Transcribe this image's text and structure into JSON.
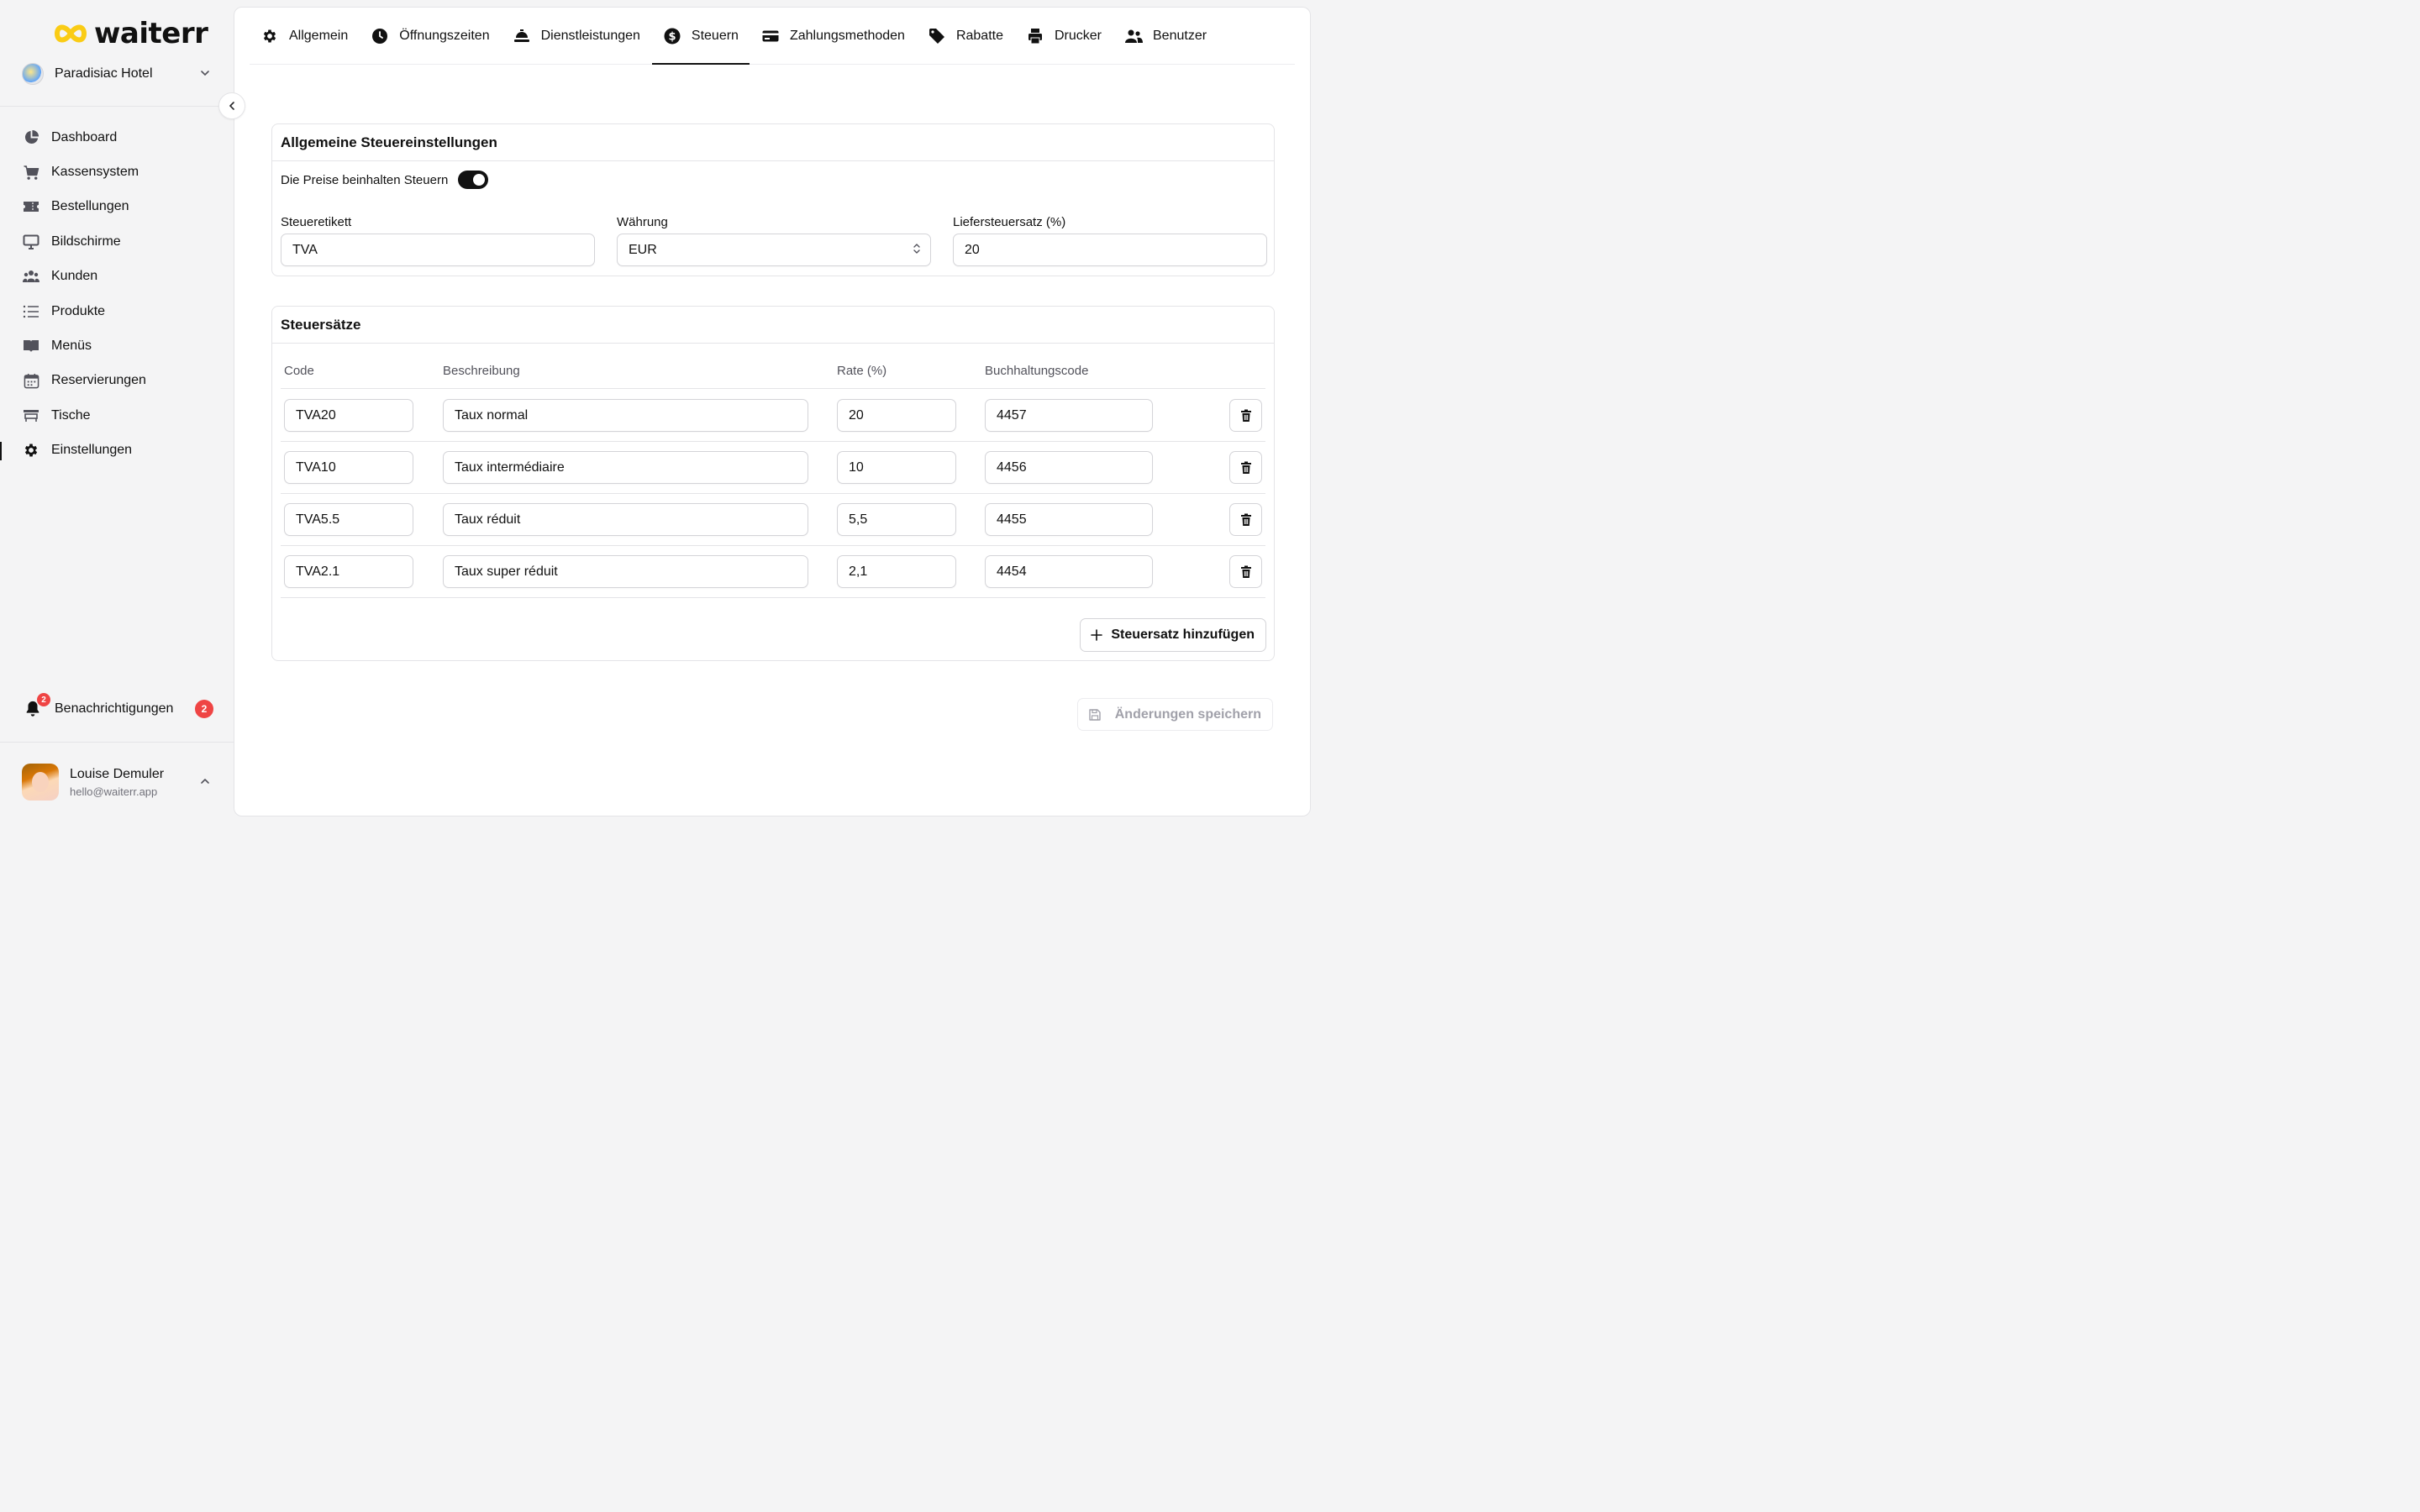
{
  "brand": {
    "name": "waiterr",
    "accent": "#facc15"
  },
  "hotel": {
    "name": "Paradisiac Hotel"
  },
  "nav": {
    "items": [
      {
        "label": "Dashboard",
        "icon": "pie-chart-icon"
      },
      {
        "label": "Kassensystem",
        "icon": "cart-icon"
      },
      {
        "label": "Bestellungen",
        "icon": "ticket-icon"
      },
      {
        "label": "Bildschirme",
        "icon": "monitor-icon"
      },
      {
        "label": "Kunden",
        "icon": "users-icon"
      },
      {
        "label": "Produkte",
        "icon": "list-icon"
      },
      {
        "label": "Menüs",
        "icon": "book-icon"
      },
      {
        "label": "Reservierungen",
        "icon": "calendar-icon"
      },
      {
        "label": "Tische",
        "icon": "table-icon"
      },
      {
        "label": "Einstellungen",
        "icon": "gear-icon"
      }
    ],
    "active": "Einstellungen"
  },
  "notifications": {
    "label": "Benachrichtigungen",
    "count": "2",
    "bell_count": "2"
  },
  "user": {
    "name": "Louise Demuler",
    "email": "hello@waiterr.app"
  },
  "tabs": [
    {
      "label": "Allgemein",
      "icon": "gear-icon"
    },
    {
      "label": "Öffnungszeiten",
      "icon": "clock-icon"
    },
    {
      "label": "Dienstleistungen",
      "icon": "service-bell-icon"
    },
    {
      "label": "Steuern",
      "icon": "dollar-circle-icon"
    },
    {
      "label": "Zahlungsmethoden",
      "icon": "credit-card-icon"
    },
    {
      "label": "Rabatte",
      "icon": "tag-icon"
    },
    {
      "label": "Drucker",
      "icon": "printer-icon"
    },
    {
      "label": "Benutzer",
      "icon": "user-group-icon"
    }
  ],
  "active_tab": "Steuern",
  "general": {
    "title": "Allgemeine Steuereinstellungen",
    "toggle_label": "Die Preise beinhalten Steuern",
    "toggle_on": true,
    "tax_label": {
      "label": "Steueretikett",
      "value": "TVA"
    },
    "currency": {
      "label": "Währung",
      "value": "EUR"
    },
    "delivery_rate": {
      "label": "Liefersteuersatz (%)",
      "value": "20"
    }
  },
  "rates": {
    "title": "Steuersätze",
    "columns": [
      "Code",
      "Beschreibung",
      "Rate (%)",
      "Buchhaltungscode"
    ],
    "rows": [
      {
        "code": "TVA20",
        "description": "Taux normal",
        "rate": "20",
        "accounting": "4457"
      },
      {
        "code": "TVA10",
        "description": "Taux intermédiaire",
        "rate": "10",
        "accounting": "4456"
      },
      {
        "code": "TVA5.5",
        "description": "Taux réduit",
        "rate": "5,5",
        "accounting": "4455"
      },
      {
        "code": "TVA2.1",
        "description": "Taux super réduit",
        "rate": "2,1",
        "accounting": "4454"
      }
    ],
    "add_label": "Steuersatz hinzufügen"
  },
  "save_label": "Änderungen speichern"
}
